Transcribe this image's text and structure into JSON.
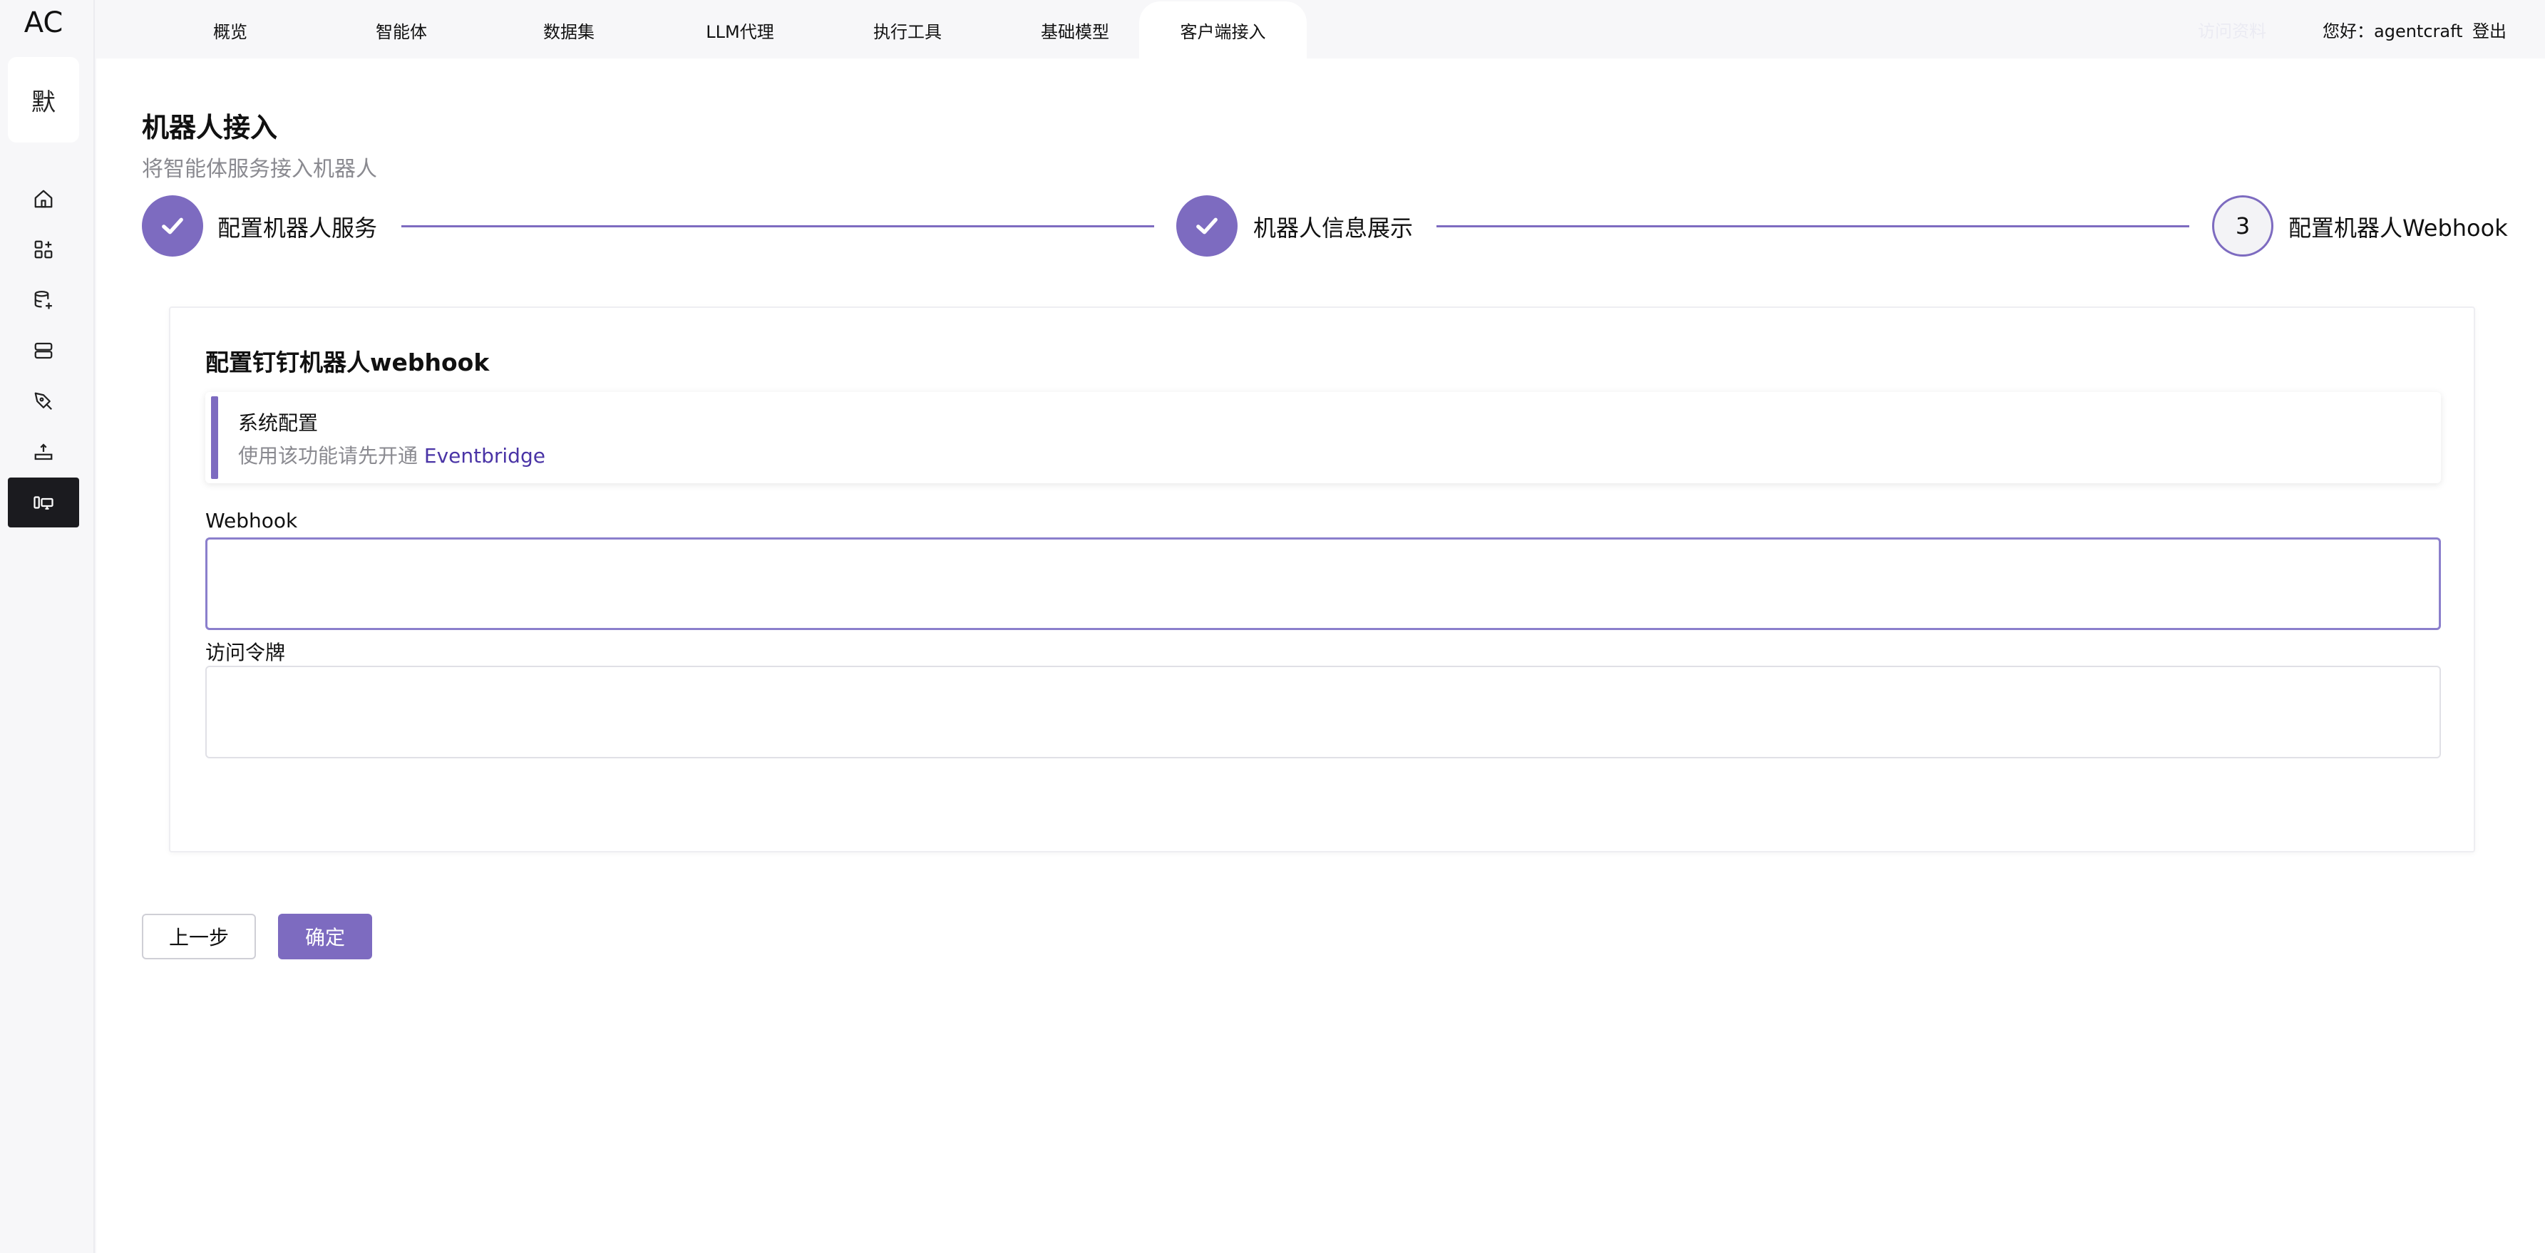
{
  "app": {
    "logo_text": "AC",
    "workspace_initial": "默"
  },
  "sidebar": {
    "items": [
      {
        "id": "home",
        "icon": "home-icon"
      },
      {
        "id": "apps",
        "icon": "apps-grid-icon"
      },
      {
        "id": "datasets",
        "icon": "database-add-icon"
      },
      {
        "id": "servers",
        "icon": "server-icon"
      },
      {
        "id": "tools",
        "icon": "pen-tool-icon"
      },
      {
        "id": "models",
        "icon": "upload-tray-icon"
      },
      {
        "id": "clients",
        "icon": "devices-icon",
        "active": true
      }
    ]
  },
  "topnav": {
    "tabs": [
      {
        "label": "概览"
      },
      {
        "label": "智能体"
      },
      {
        "label": "数据集"
      },
      {
        "label": "LLM代理"
      },
      {
        "label": "执行工具"
      },
      {
        "label": "基础模型"
      },
      {
        "label": "客户端接入",
        "active": true
      }
    ],
    "docs_label": "访问资料",
    "greeting": "您好：agentcraft",
    "logout_label": "登出"
  },
  "page": {
    "title": "机器人接入",
    "subtitle": "将智能体服务接入机器人"
  },
  "steps": [
    {
      "label": "配置机器人服务",
      "status": "done"
    },
    {
      "label": "机器人信息展示",
      "status": "done"
    },
    {
      "number": "3",
      "label": "配置机器人Webhook",
      "status": "current"
    }
  ],
  "card": {
    "title": "配置钉钉机器人webhook",
    "alert": {
      "title": "系统配置",
      "description": "使用该功能请先开通 ",
      "link_text": "Eventbridge"
    },
    "fields": [
      {
        "label": "Webhook",
        "value": "",
        "placeholder": ""
      },
      {
        "label": "访问令牌",
        "value": "",
        "placeholder": ""
      }
    ]
  },
  "actions": {
    "prev_label": "上一步",
    "confirm_label": "确定"
  },
  "colors": {
    "accent": "#7d6bc0",
    "link": "#4a34a6",
    "sidebar_active": "#1b1b1f"
  }
}
